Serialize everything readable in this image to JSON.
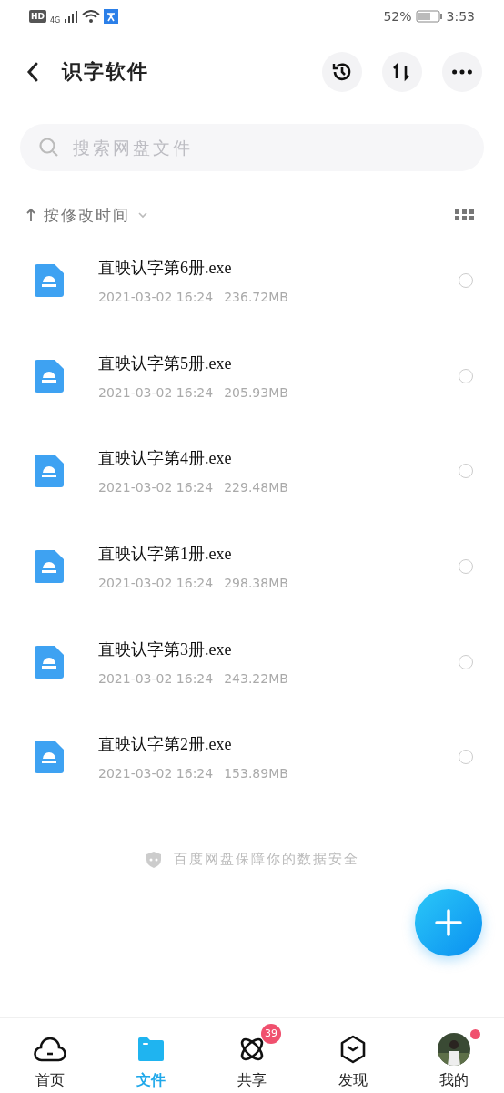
{
  "status_bar": {
    "hd": "HD",
    "network": "4G",
    "battery": "52%",
    "time": "3:53"
  },
  "header": {
    "title": "识字软件"
  },
  "search": {
    "placeholder": "搜索网盘文件"
  },
  "sort": {
    "label": "按修改时间"
  },
  "files": [
    {
      "name": "直映认字第6册.exe",
      "date": "2021-03-02 16:24",
      "size": "236.72MB",
      "selected": false
    },
    {
      "name": "直映认字第5册.exe",
      "date": "2021-03-02 16:24",
      "size": "205.93MB",
      "selected": false
    },
    {
      "name": "直映认字第4册.exe",
      "date": "2021-03-02 16:24",
      "size": "229.48MB",
      "selected": false
    },
    {
      "name": "直映认字第1册.exe",
      "date": "2021-03-02 16:24",
      "size": "298.38MB",
      "selected": false
    },
    {
      "name": "直映认字第3册.exe",
      "date": "2021-03-02 16:24",
      "size": "243.22MB",
      "selected": false
    },
    {
      "name": "直映认字第2册.exe",
      "date": "2021-03-02 16:24",
      "size": "153.89MB",
      "selected": false
    }
  ],
  "footer_note": "百度网盘保障你的数据安全",
  "tabs": [
    {
      "label": "首页",
      "kind": "home",
      "selected": false
    },
    {
      "label": "文件",
      "kind": "files",
      "selected": true
    },
    {
      "label": "共享",
      "kind": "share",
      "selected": false,
      "badge": "39"
    },
    {
      "label": "发现",
      "kind": "discover",
      "selected": false
    },
    {
      "label": "我的",
      "kind": "profile",
      "selected": false,
      "dot": true
    }
  ]
}
